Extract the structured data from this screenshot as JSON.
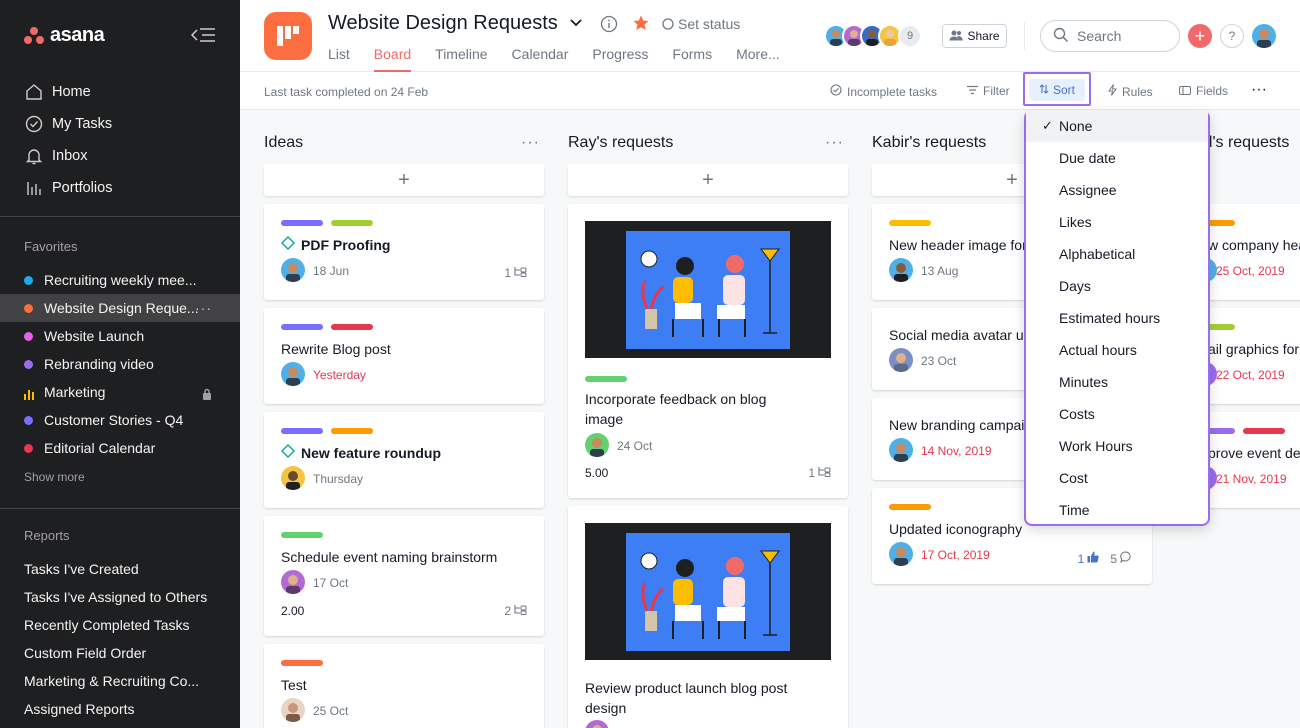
{
  "sidebar": {
    "logo": "asana",
    "nav": [
      {
        "label": "Home",
        "icon": "home-icon"
      },
      {
        "label": "My Tasks",
        "icon": "check-circle-icon"
      },
      {
        "label": "Inbox",
        "icon": "bell-icon"
      },
      {
        "label": "Portfolios",
        "icon": "bar-chart-icon"
      }
    ],
    "favorites_title": "Favorites",
    "favorites": [
      {
        "label": "Recruiting weekly mee...",
        "color": "#20aaea"
      },
      {
        "label": "Website Design Reque...",
        "color": "#fc6d3f",
        "active": true,
        "more": "···"
      },
      {
        "label": "Website Launch",
        "color": "#e362e3"
      },
      {
        "label": "Rebranding video",
        "color": "#9b6cf0"
      },
      {
        "label": "Marketing",
        "color": "#fcbd01",
        "icon": "bar-chart-icon",
        "locked": true
      },
      {
        "label": "Customer Stories - Q4",
        "color": "#796eff"
      },
      {
        "label": "Editorial Calendar",
        "color": "#e8384f"
      }
    ],
    "show_more": "Show more",
    "reports_title": "Reports",
    "reports": [
      "Tasks I've Created",
      "Tasks I've Assigned to Others",
      "Recently Completed Tasks",
      "Custom Field Order",
      "Marketing & Recruiting Co...",
      "Assigned Reports"
    ]
  },
  "header": {
    "title": "Website Design Requests",
    "set_status": "Set status",
    "tabs": [
      "List",
      "Board",
      "Timeline",
      "Calendar",
      "Progress",
      "Forms",
      "More..."
    ],
    "active_tab": "Board",
    "member_count": "9",
    "share_label": "Share",
    "search_placeholder": "Search",
    "help_label": "?"
  },
  "toolbar": {
    "last_task": "Last task completed on 24 Feb",
    "incomplete": "Incomplete tasks",
    "filter": "Filter",
    "sort": "Sort",
    "rules": "Rules",
    "fields": "Fields",
    "more": "···"
  },
  "columns": [
    {
      "title": "Ideas",
      "cards": [
        {
          "tags": [
            "#796eff",
            "#a4cf30"
          ],
          "title": "PDF Proofing",
          "milestone": true,
          "date": "18 Jun",
          "subtasks": "1"
        },
        {
          "tags": [
            "#796eff",
            "#e8384f"
          ],
          "title": "Rewrite Blog post",
          "date": "Yesterday",
          "date_red": true
        },
        {
          "tags": [
            "#796eff",
            "#fd9a00"
          ],
          "title": "New feature roundup",
          "milestone": true,
          "date": "Thursday"
        },
        {
          "tags": [
            "#62d26f"
          ],
          "title": "Schedule event naming brainstorm",
          "date": "17 Oct",
          "number": "2.00",
          "subtasks": "2"
        },
        {
          "tags": [
            "#fc6d3f"
          ],
          "title": "Test",
          "date": "25 Oct"
        }
      ]
    },
    {
      "title": "Ray's requests",
      "cards": [
        {
          "tags": [
            "#62d26f"
          ],
          "title_lines": [
            "Incorporate feedback on blog",
            "image"
          ],
          "date": "24 Oct",
          "number": "5.00",
          "subtasks": "1"
        },
        {
          "title_lines": [
            "Review product launch blog post",
            "design"
          ]
        }
      ]
    },
    {
      "title": "Kabir's requests",
      "cards": [
        {
          "tags": [
            "#fcbd01"
          ],
          "title": "New header image for",
          "date": "13 Aug"
        },
        {
          "title": "Social media avatar up",
          "date": "23 Oct"
        },
        {
          "title": "New branding campaig",
          "date": "14 Nov, 2019",
          "date_red": true
        },
        {
          "tags": [
            "#fd9a00"
          ],
          "title": "Updated iconography",
          "date": "17 Oct, 2019",
          "date_red": true,
          "likes": "1",
          "comments": "5"
        }
      ]
    },
    {
      "title": "el's requests",
      "cards": [
        {
          "tags": [
            "#fd9a00"
          ],
          "title": "w company hea",
          "date": "25 Oct, 2019",
          "date_red": true
        },
        {
          "tags": [
            "#a4cf30"
          ],
          "title": "ail graphics for",
          "date": "22 Oct, 2019",
          "date_red": true
        },
        {
          "tags": [
            "#9b6cf0",
            "#e8384f"
          ],
          "title": "prove event de",
          "date": "21 Nov, 2019",
          "date_red": true
        }
      ]
    }
  ],
  "sort_menu": {
    "selected": "None",
    "check": "✓",
    "options": [
      "None",
      "Due date",
      "Assignee",
      "Likes",
      "Alphabetical",
      "Days",
      "Estimated hours",
      "Actual hours",
      "Minutes",
      "Costs",
      "Work Hours",
      "Cost",
      "Time"
    ]
  }
}
